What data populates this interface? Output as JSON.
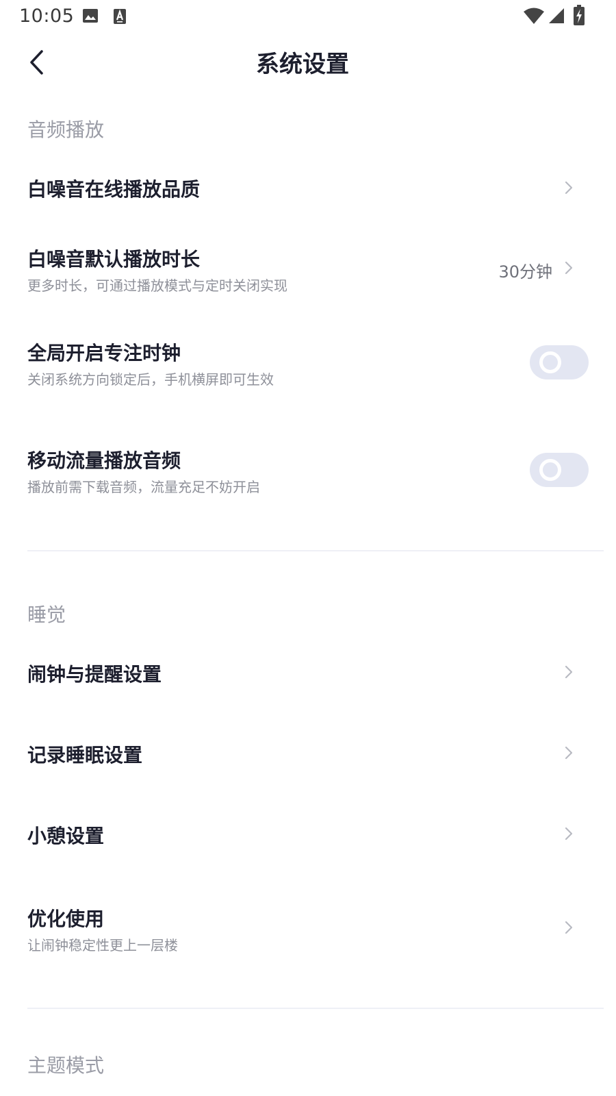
{
  "status_bar": {
    "time": "10:05",
    "left_icons": [
      "image-icon",
      "a-keyboard-icon"
    ],
    "right_icons": [
      "wifi-icon",
      "signal-icon",
      "battery-charging-icon"
    ]
  },
  "header": {
    "title": "系统设置",
    "back_icon": "back-arrow-icon"
  },
  "sections": {
    "audio": {
      "header": "音频播放",
      "quality": {
        "title": "白噪音在线播放品质"
      },
      "duration": {
        "title": "白噪音默认播放时长",
        "subtitle": "更多时长，可通过播放模式与定时关闭实现",
        "value": "30分钟"
      },
      "focus_clock": {
        "title": "全局开启专注时钟",
        "subtitle": "关闭系统方向锁定后，手机横屏即可生效",
        "enabled": false
      },
      "mobile_data": {
        "title": "移动流量播放音频",
        "subtitle": "播放前需下载音频，流量充足不妨开启",
        "enabled": false
      }
    },
    "sleep": {
      "header": "睡觉",
      "alarm": {
        "title": "闹钟与提醒设置"
      },
      "record": {
        "title": "记录睡眠设置"
      },
      "nap": {
        "title": "小憩设置"
      },
      "optimize": {
        "title": "优化使用",
        "subtitle": "让闹钟稳定性更上一层楼"
      }
    },
    "theme": {
      "header": "主题模式"
    }
  },
  "colors": {
    "title_text": "#1d1f2e",
    "section_header": "#9a9ca6",
    "subtitle_text": "#8e9099",
    "toggle_off_track": "#e3e6f2",
    "chevron": "#b8bac2",
    "divider": "#eef0f6"
  }
}
